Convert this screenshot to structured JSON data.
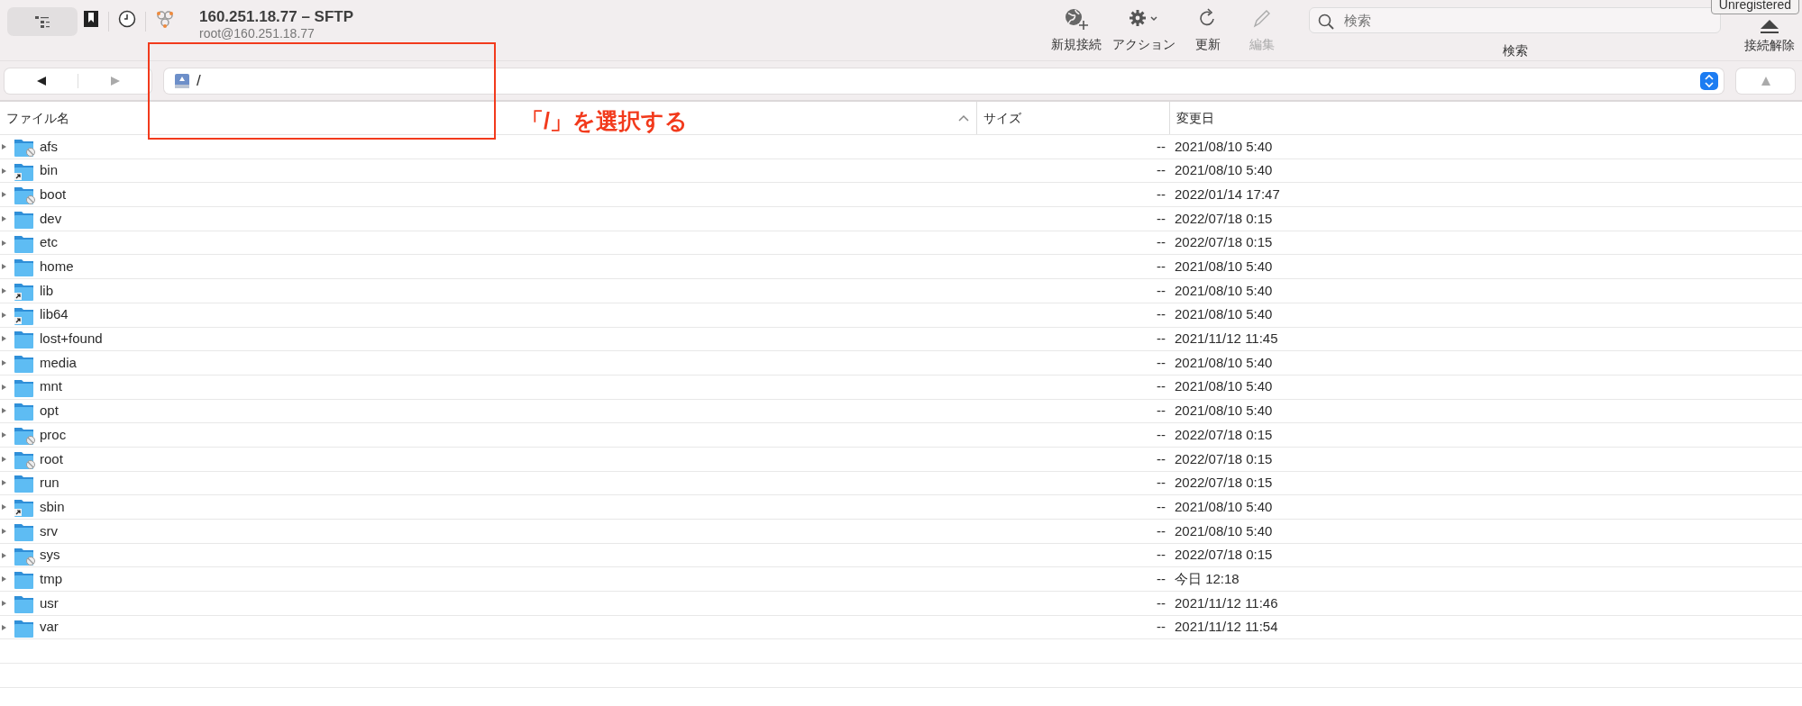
{
  "window": {
    "title": "160.251.18.77 – SFTP",
    "subtitle": "root@160.251.18.77"
  },
  "toolbar": {
    "sidebar_toggle": {
      "selected": true
    },
    "buttons": [
      {
        "kind": "new",
        "label": "新規接続",
        "disabled": false
      },
      {
        "kind": "action",
        "label": "アクション",
        "disabled": false
      },
      {
        "kind": "refresh",
        "label": "更新",
        "disabled": false
      },
      {
        "kind": "edit",
        "label": "編集",
        "disabled": true
      }
    ],
    "search": {
      "placeholder": "検索",
      "label": "検索"
    },
    "badge": "Unregistered",
    "disconnect": {
      "label": "接続解除"
    }
  },
  "navigation": {
    "back": {
      "disabled": false
    },
    "forward": {
      "disabled": true
    },
    "up": {
      "disabled": true
    },
    "path": "/"
  },
  "table": {
    "columns": [
      {
        "label": "ファイル名",
        "sorted": true
      },
      {
        "label": "サイズ",
        "sorted": false
      },
      {
        "label": "変更日",
        "sorted": false
      }
    ],
    "rows": [
      {
        "name": "afs",
        "kind": "restricted",
        "size": "--",
        "modified": "2021/08/10 5:40"
      },
      {
        "name": "bin",
        "kind": "link",
        "size": "--",
        "modified": "2021/08/10 5:40"
      },
      {
        "name": "boot",
        "kind": "restricted",
        "size": "--",
        "modified": "2022/01/14 17:47"
      },
      {
        "name": "dev",
        "kind": "folder",
        "size": "--",
        "modified": "2022/07/18 0:15"
      },
      {
        "name": "etc",
        "kind": "folder",
        "size": "--",
        "modified": "2022/07/18 0:15"
      },
      {
        "name": "home",
        "kind": "folder",
        "size": "--",
        "modified": "2021/08/10 5:40"
      },
      {
        "name": "lib",
        "kind": "link",
        "size": "--",
        "modified": "2021/08/10 5:40"
      },
      {
        "name": "lib64",
        "kind": "link",
        "size": "--",
        "modified": "2021/08/10 5:40"
      },
      {
        "name": "lost+found",
        "kind": "folder",
        "size": "--",
        "modified": "2021/11/12 11:45"
      },
      {
        "name": "media",
        "kind": "folder",
        "size": "--",
        "modified": "2021/08/10 5:40"
      },
      {
        "name": "mnt",
        "kind": "folder",
        "size": "--",
        "modified": "2021/08/10 5:40"
      },
      {
        "name": "opt",
        "kind": "folder",
        "size": "--",
        "modified": "2021/08/10 5:40"
      },
      {
        "name": "proc",
        "kind": "restricted",
        "size": "--",
        "modified": "2022/07/18 0:15"
      },
      {
        "name": "root",
        "kind": "restricted",
        "size": "--",
        "modified": "2022/07/18 0:15"
      },
      {
        "name": "run",
        "kind": "folder",
        "size": "--",
        "modified": "2022/07/18 0:15"
      },
      {
        "name": "sbin",
        "kind": "link",
        "size": "--",
        "modified": "2021/08/10 5:40"
      },
      {
        "name": "srv",
        "kind": "folder",
        "size": "--",
        "modified": "2021/08/10 5:40"
      },
      {
        "name": "sys",
        "kind": "restricted",
        "size": "--",
        "modified": "2022/07/18 0:15"
      },
      {
        "name": "tmp",
        "kind": "folder",
        "size": "--",
        "modified": "今日 12:18"
      },
      {
        "name": "usr",
        "kind": "folder",
        "size": "--",
        "modified": "2021/11/12 11:46"
      },
      {
        "name": "var",
        "kind": "folder",
        "size": "--",
        "modified": "2021/11/12 11:54"
      }
    ]
  },
  "annotation": {
    "text": "「/」を選択する"
  }
}
